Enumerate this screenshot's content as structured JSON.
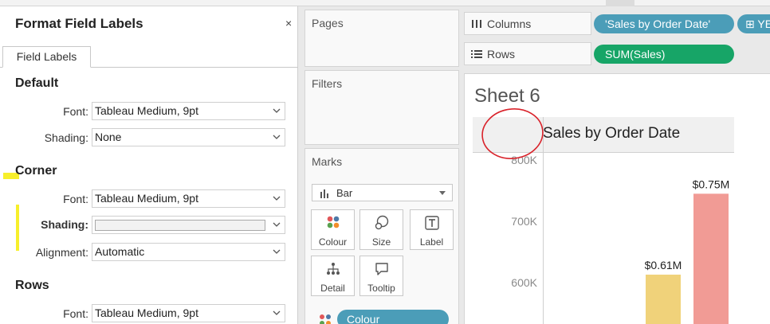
{
  "format_pane": {
    "title": "Format Field Labels",
    "close": "×",
    "tab": "Field Labels",
    "sections": {
      "default": {
        "heading": "Default",
        "font_label": "Font:",
        "font_value": "Tableau Medium, 9pt",
        "shading_label": "Shading:",
        "shading_value": "None"
      },
      "corner": {
        "heading": "Corner",
        "font_label": "Font:",
        "font_value": "Tableau Medium, 9pt",
        "shading_label": "Shading:",
        "alignment_label": "Alignment:",
        "alignment_value": "Automatic"
      },
      "rows": {
        "heading": "Rows",
        "font_label": "Font:",
        "font_value": "Tableau Medium, 9pt"
      }
    }
  },
  "cards": {
    "pages": "Pages",
    "filters": "Filters",
    "marks": {
      "title": "Marks",
      "type": "Bar",
      "buttons": [
        "Colour",
        "Size",
        "Label",
        "Detail",
        "Tooltip"
      ],
      "colour_pill": "Colour"
    }
  },
  "shelves": {
    "columns_label": "Columns",
    "rows_label": "Rows",
    "columns_pills": [
      "'Sales by Order Date'",
      "YE"
    ],
    "rows_pills": [
      "SUM(Sales)"
    ]
  },
  "sheet": {
    "title": "Sheet 6",
    "header": "Sales by Order Date"
  },
  "colors": {
    "pill_blue": "#4b9db8",
    "pill_green": "#17a567",
    "bar_yellow": "#f0d27a",
    "bar_red": "#f19b95",
    "highlight_yellow": "#f7ef2b",
    "annotation_red": "#d9232b"
  },
  "chart_data": {
    "type": "bar",
    "ylim": [
      525000,
      830000
    ],
    "yticks": [
      {
        "value": 600000,
        "label": "600K"
      },
      {
        "value": 700000,
        "label": "700K"
      },
      {
        "value": 800000,
        "label": "800K"
      }
    ],
    "series": [
      {
        "value": 613000,
        "label": "$0.61M",
        "color": "#f0d27a"
      },
      {
        "value": 745000,
        "label": "$0.75M",
        "color": "#f19b95"
      }
    ]
  }
}
